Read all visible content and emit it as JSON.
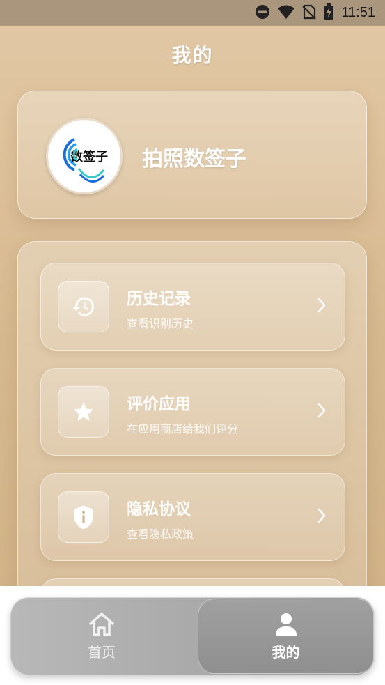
{
  "status_bar": {
    "time": "11:51"
  },
  "header": {
    "title": "我的"
  },
  "profile": {
    "avatar_text": "数签子",
    "name": "拍照数签子"
  },
  "menu": {
    "items": [
      {
        "title": "历史记录",
        "subtitle": "查看识别历史",
        "icon": "history-icon"
      },
      {
        "title": "评价应用",
        "subtitle": "在应用商店给我们评分",
        "icon": "star-icon"
      },
      {
        "title": "隐私协议",
        "subtitle": "查看隐私政策",
        "icon": "shield-info-icon"
      }
    ]
  },
  "tabbar": {
    "tabs": [
      {
        "label": "首页",
        "icon": "home-icon",
        "active": false
      },
      {
        "label": "我的",
        "icon": "person-icon",
        "active": true
      }
    ]
  },
  "colors": {
    "accent_bg": "#d6b98f",
    "tab_active": "#8f8f8f"
  }
}
